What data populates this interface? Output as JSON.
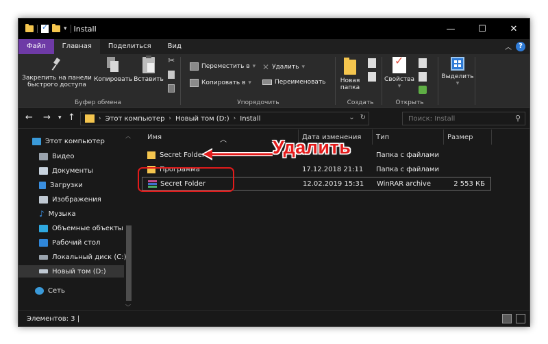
{
  "window": {
    "title": "Install",
    "controls": {
      "minimize": "—",
      "maximize": "☐",
      "close": "✕"
    }
  },
  "tabs": [
    {
      "label": "Файл"
    },
    {
      "label": "Главная"
    },
    {
      "label": "Поделиться"
    },
    {
      "label": "Вид"
    }
  ],
  "ribbon": {
    "clipboard": {
      "pin": "Закрепить на панели быстрого доступа",
      "copy": "Копировать",
      "paste": "Вставить",
      "group": "Буфер обмена"
    },
    "organize": {
      "move": "Переместить в",
      "copy_to": "Копировать в",
      "delete": "Удалить",
      "rename": "Переименовать",
      "group": "Упорядочить"
    },
    "new": {
      "new_folder": "Новая папка",
      "group": "Создать"
    },
    "open": {
      "properties": "Свойства",
      "group": "Открыть"
    },
    "select": {
      "label": "Выделить"
    }
  },
  "address": {
    "crumbs": [
      "Этот компьютер",
      "Новый том (D:)",
      "Install"
    ],
    "search_placeholder": "Поиск: Install"
  },
  "nav": {
    "items": [
      {
        "label": "Этот компьютер",
        "icon": "computer-icon",
        "color": "#3a9ad9"
      },
      {
        "label": "Видео",
        "icon": "video-icon",
        "color": "#9aa3ad"
      },
      {
        "label": "Документы",
        "icon": "documents-icon",
        "color": "#c8d3de"
      },
      {
        "label": "Загрузки",
        "icon": "download-icon",
        "color": "#3a8fe0"
      },
      {
        "label": "Изображения",
        "icon": "pictures-icon",
        "color": "#bfc8d2"
      },
      {
        "label": "Музыка",
        "icon": "music-icon",
        "color": "#3a8fe0"
      },
      {
        "label": "Объемные объекты",
        "icon": "3d-objects-icon",
        "color": "#2fa8e0"
      },
      {
        "label": "Рабочий стол",
        "icon": "desktop-icon",
        "color": "#2f86d9"
      },
      {
        "label": "Локальный диск (C:)",
        "icon": "system-drive-icon",
        "color": "#9aa3ad"
      },
      {
        "label": "Новый том (D:)",
        "icon": "drive-icon",
        "color": "#bfc8d2"
      },
      {
        "label": "Сеть",
        "icon": "network-icon",
        "color": "#3a9ad9"
      }
    ]
  },
  "columns": {
    "name": "Имя",
    "date": "Дата изменения",
    "type": "Тип",
    "size": "Размер"
  },
  "files": [
    {
      "name": "Secret Folder",
      "date": "",
      "type": "Папка с файлами",
      "size": "",
      "icon": "folder-icon"
    },
    {
      "name": "Программа",
      "date": "17.12.2018 21:11",
      "type": "Папка с файлами",
      "size": "",
      "icon": "folder-icon"
    },
    {
      "name": "Secret Folder",
      "date": "12.02.2019 15:31",
      "type": "WinRAR archive",
      "size": "2 553 КБ",
      "icon": "winrar-archive-icon"
    }
  ],
  "annotation": {
    "text": "Удалить",
    "color": "#e31b1b"
  },
  "status": {
    "items_text": "Элементов: 3"
  }
}
